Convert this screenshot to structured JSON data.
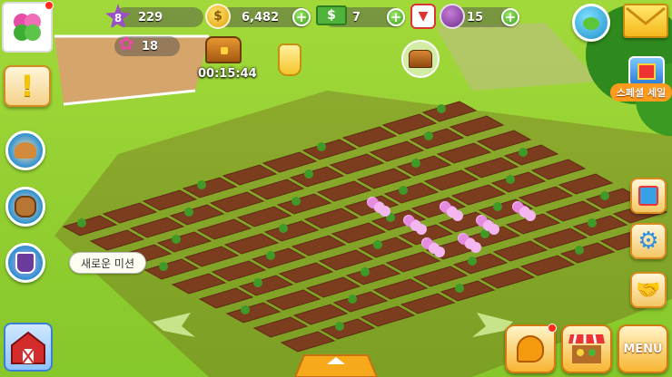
{
  "hud": {
    "level": "8",
    "xp": "229",
    "coins": "6,482",
    "cash": "7",
    "vouchers": "15",
    "reputation": "18",
    "timer": "00:15:44"
  },
  "tooltip": {
    "new_mission": "새로운 미션"
  },
  "sale_banner": {
    "label": "스페셜 세일"
  },
  "menu": {
    "label": "MENU"
  },
  "icons": {
    "profile": "clover-icon",
    "level": "star-icon",
    "coin": "dollar-coin-icon",
    "cash": "cash-bill-icon",
    "voucher": "voucher-icon",
    "potion": "potion-icon",
    "reputation": "heart-clover-icon",
    "chest": "treasure-chest-icon",
    "mail": "envelope-icon",
    "globe": "globe-icon",
    "gift": "gift-icon",
    "settings": "gear-icon",
    "friends": "handshake-icon",
    "barn": "barn-icon",
    "market": "market-stall-icon",
    "alert": "exclamation-icon"
  },
  "colors": {
    "grass": "#8fcf2e",
    "soil": "#7a3b1e",
    "accent_orange": "#f7b531",
    "plus_green": "#3c9f1a"
  }
}
